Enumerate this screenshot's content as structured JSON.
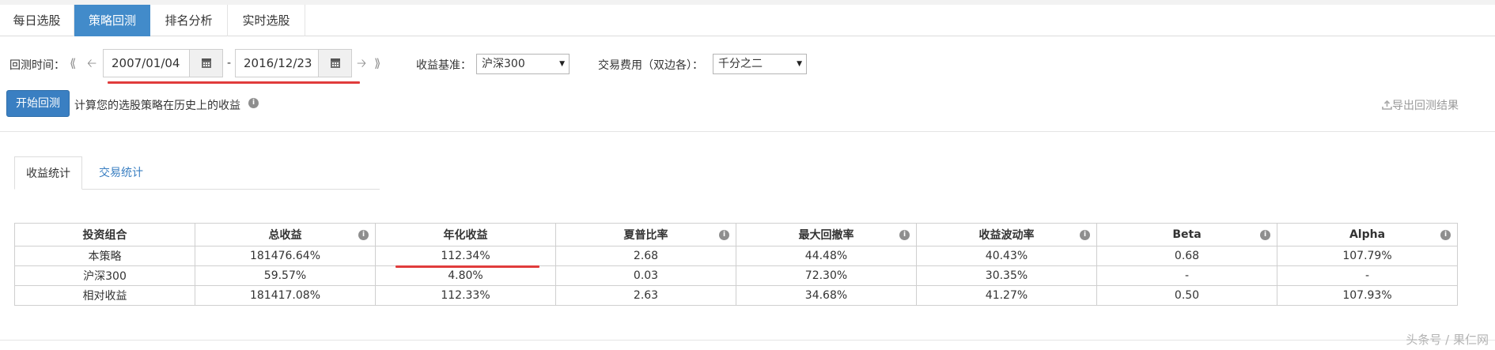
{
  "nav_tabs": [
    {
      "label": "每日选股",
      "active": false
    },
    {
      "label": "策略回测",
      "active": true
    },
    {
      "label": "排名分析",
      "active": false
    },
    {
      "label": "实时选股",
      "active": false
    }
  ],
  "backtest": {
    "time_label": "回测时间：",
    "start_date": "2007/01/04",
    "date_separator": "-",
    "end_date": "2016/12/23",
    "benchmark_label": "收益基准：",
    "benchmark_value": "沪深300",
    "fee_label": "交易费用（双边各）：",
    "fee_value": "千分之二",
    "start_button": "开始回测",
    "description": "计算您的选股策略在历史上的收益",
    "export_label": "导出回测结果"
  },
  "sub_tabs": [
    {
      "label": "收益统计",
      "active": true
    },
    {
      "label": "交易统计",
      "active": false
    }
  ],
  "table": {
    "headers": [
      {
        "label": "投资组合",
        "info": false
      },
      {
        "label": "总收益",
        "info": true
      },
      {
        "label": "年化收益",
        "info": false
      },
      {
        "label": "夏普比率",
        "info": true
      },
      {
        "label": "最大回撤率",
        "info": true
      },
      {
        "label": "收益波动率",
        "info": true
      },
      {
        "label": "Beta",
        "info": true
      },
      {
        "label": "Alpha",
        "info": true
      }
    ],
    "rows": [
      [
        "本策略",
        "181476.64%",
        "112.34%",
        "2.68",
        "44.48%",
        "40.43%",
        "0.68",
        "107.79%"
      ],
      [
        "沪深300",
        "59.57%",
        "4.80%",
        "0.03",
        "72.30%",
        "30.35%",
        "-",
        "-"
      ],
      [
        "相对收益",
        "181417.08%",
        "112.33%",
        "2.63",
        "34.68%",
        "41.27%",
        "0.50",
        "107.93%"
      ]
    ]
  },
  "watermark": "头条号 / 果仁网",
  "colors": {
    "primary": "#428bca",
    "highlight_underline": "#e03c3c",
    "link": "#3a7fc2"
  }
}
